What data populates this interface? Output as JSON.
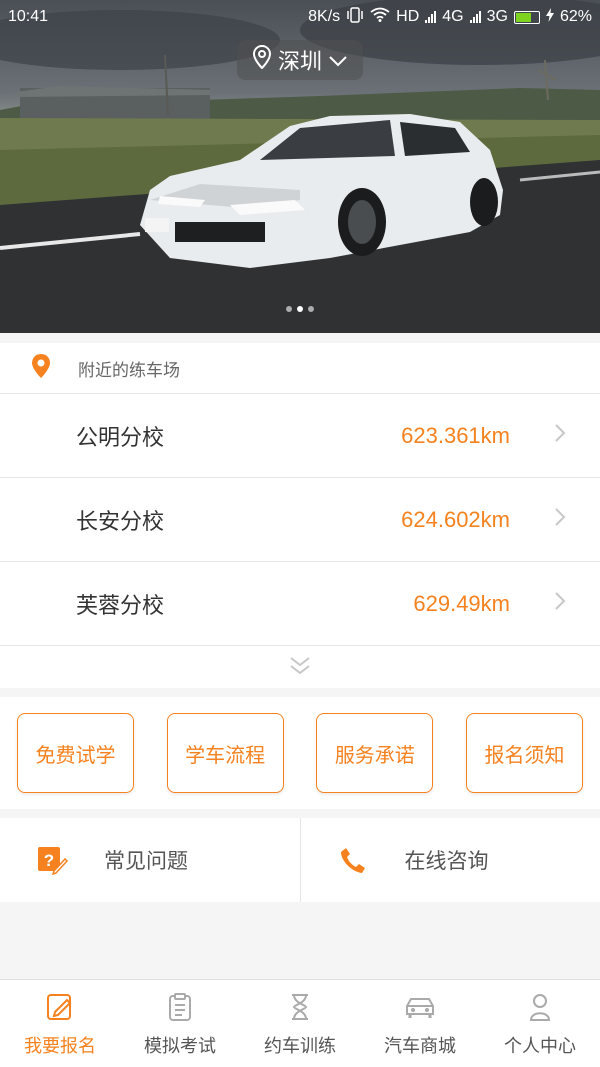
{
  "status_bar": {
    "time": "10:41",
    "net_speed": "8K/s",
    "hd": "HD",
    "net_4g": "4G",
    "net_3g": "3G",
    "battery": "62%"
  },
  "header": {
    "city": "深圳"
  },
  "banner": {
    "slide_count": 3,
    "active_index": 1
  },
  "nearby": {
    "title": "附近的练车场",
    "schools": [
      {
        "name": "公明分校",
        "distance": "623.361km"
      },
      {
        "name": "长安分校",
        "distance": "624.602km"
      },
      {
        "name": "芙蓉分校",
        "distance": "629.49km"
      }
    ]
  },
  "actions": [
    {
      "label": "免费试学"
    },
    {
      "label": "学车流程"
    },
    {
      "label": "服务承诺"
    },
    {
      "label": "报名须知"
    }
  ],
  "help": {
    "faq": "常见问题",
    "consult": "在线咨询"
  },
  "tabs": [
    {
      "label": "我要报名",
      "icon": "pencil-icon",
      "active": true
    },
    {
      "label": "模拟考试",
      "icon": "clipboard-icon",
      "active": false
    },
    {
      "label": "约车训练",
      "icon": "hourglass-icon",
      "active": false
    },
    {
      "label": "汽车商城",
      "icon": "car-icon",
      "active": false
    },
    {
      "label": "个人中心",
      "icon": "person-icon",
      "active": false
    }
  ],
  "colors": {
    "accent": "#f5821f",
    "text": "#333333",
    "muted": "#999999"
  }
}
